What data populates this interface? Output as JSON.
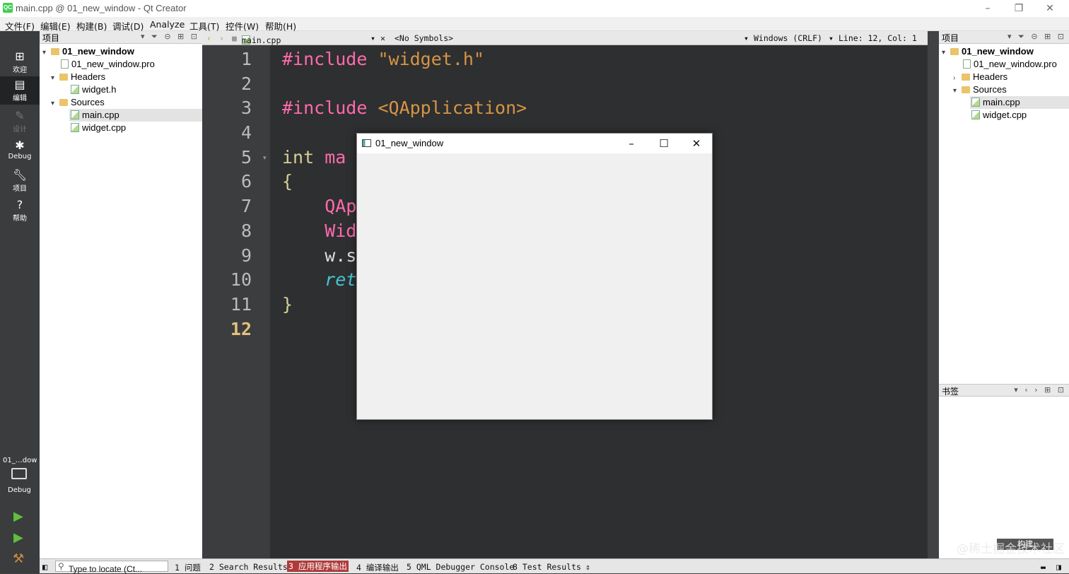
{
  "window": {
    "title": "main.cpp @ 01_new_window - Qt Creator",
    "app_icon": "QC"
  },
  "menubar": [
    "文件(F)",
    "编辑(E)",
    "构建(B)",
    "调试(D)",
    "Analyze",
    "工具(T)",
    "控件(W)",
    "帮助(H)"
  ],
  "modes": [
    {
      "label": "欢迎",
      "icon": "grid-icon"
    },
    {
      "label": "编辑",
      "icon": "edit-icon"
    },
    {
      "label": "设计",
      "icon": "pencil-icon"
    },
    {
      "label": "Debug",
      "icon": "bug-icon"
    },
    {
      "label": "项目",
      "icon": "wrench-icon"
    },
    {
      "label": "帮助",
      "icon": "help-icon"
    }
  ],
  "kit": {
    "project": "01_…dow",
    "target": "Debug"
  },
  "left_panel": {
    "title": "项目",
    "tree": [
      {
        "label": "01_new_window",
        "bold": true
      },
      {
        "label": "01_new_window.pro"
      },
      {
        "label": "Headers"
      },
      {
        "label": "widget.h"
      },
      {
        "label": "Sources"
      },
      {
        "label": "main.cpp"
      },
      {
        "label": "widget.cpp"
      }
    ]
  },
  "editor_bar": {
    "file": "main.cpp",
    "symbols": "<No Symbols>",
    "encoding": "Windows (CRLF)",
    "position": "Line: 12, Col: 1"
  },
  "editor": {
    "line_numbers": [
      "1",
      "2",
      "3",
      "4",
      "5",
      "6",
      "7",
      "8",
      "9",
      "10",
      "11",
      "12"
    ],
    "lines": [
      {
        "a": "#include ",
        "b": "\"widget.h\""
      },
      {
        "a": "",
        "b": ""
      },
      {
        "a": "#include ",
        "b": "<QApplication>"
      },
      {
        "a": "",
        "b": ""
      },
      {
        "a": "int ",
        "b": "ma"
      },
      {
        "a": "{",
        "b": ""
      },
      {
        "a": "    QAp",
        "b": ""
      },
      {
        "a": "    Wid",
        "b": ""
      },
      {
        "a": "    w.s",
        "b": ""
      },
      {
        "a": "    ret",
        "b": ""
      },
      {
        "a": "}",
        "b": ""
      },
      {
        "a": "",
        "b": ""
      }
    ]
  },
  "app_window": {
    "title": "01_new_window",
    "minimize": "–",
    "maximize": "☐",
    "close": "✕"
  },
  "right_panel": {
    "title": "项目",
    "tree": [
      {
        "label": "01_new_window"
      },
      {
        "label": "01_new_window.pro"
      },
      {
        "label": "Headers"
      },
      {
        "label": "Sources"
      },
      {
        "label": "main.cpp"
      },
      {
        "label": "widget.cpp"
      }
    ],
    "bookmarks_title": "书签"
  },
  "statusbar": {
    "locate_placeholder": "Type to locate (Ct...",
    "tabs": [
      "1 问题",
      "2 Search Results",
      "3 应用程序输出",
      "4 编译输出",
      "5 QML Debugger Console",
      "8 Test Results"
    ]
  },
  "build_tip": "构建",
  "watermark": "@稀土掘金技术社区",
  "colors": {
    "accent_output_tab": "#c0392b",
    "editor_bg": "#2e2f30"
  }
}
